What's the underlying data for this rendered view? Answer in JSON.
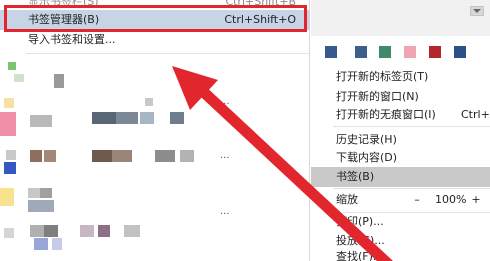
{
  "submenu": {
    "items": [
      {
        "label": "显示书签栏(S)",
        "shortcut": "Ctrl+Shift+B"
      },
      {
        "label": "书签管理器(B)",
        "shortcut": "Ctrl+Shift+O"
      },
      {
        "label": "导入书签和设置..."
      }
    ],
    "more_marker": "..."
  },
  "chrome_menu": {
    "items": [
      {
        "label": "打开新的标签页(T)"
      },
      {
        "label": "打开新的窗口(N)"
      },
      {
        "label": "打开新的无痕窗口(I)",
        "shortcut": "Ctrl+S"
      },
      {
        "label": "历史记录(H)"
      },
      {
        "label": "下载内容(D)"
      },
      {
        "label": "书签(B)"
      }
    ],
    "zoom": {
      "label": "缩放",
      "minus": "–",
      "value": "100%",
      "plus": "+"
    },
    "items_bottom": [
      {
        "label": "打印(P)..."
      },
      {
        "label": "投放(C)..."
      },
      {
        "label": "查找(F)..."
      }
    ],
    "swatch_colors": [
      "#3a5a8c",
      "#3d5f8c",
      "#3f8a6a",
      "#f0a6b2",
      "#b4262b",
      "#2d5187"
    ]
  },
  "annotation_color": "#e2262e"
}
